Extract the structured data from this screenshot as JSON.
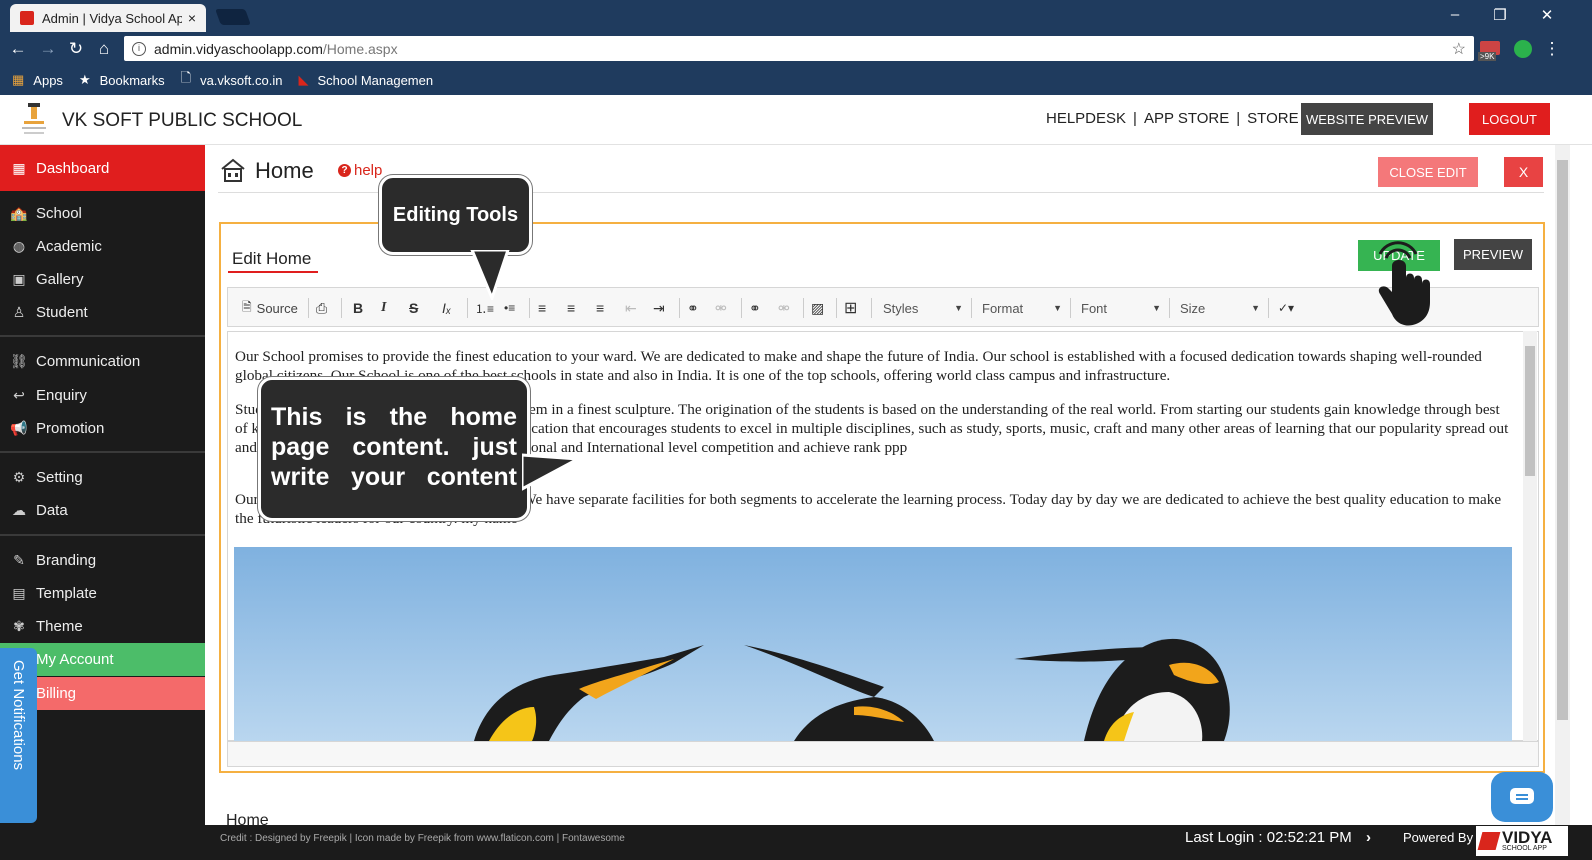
{
  "browser": {
    "tab_title": "Admin | Vidya School App",
    "tab_close": "×",
    "url_host": "admin.vidyaschoolapp.com",
    "url_path": "/Home.aspx",
    "ext_badge": ">9K",
    "bookmarks": [
      {
        "label": "Apps",
        "icon": "apps-grid-icon"
      },
      {
        "label": "Bookmarks",
        "icon": "star-icon"
      },
      {
        "label": "va.vksoft.co.in",
        "icon": "page-icon"
      },
      {
        "label": "School Managemen",
        "icon": "school-favicon"
      }
    ]
  },
  "header": {
    "school_name": "VK SOFT PUBLIC SCHOOL",
    "links": [
      "HELPDESK",
      "APP STORE",
      "STORE"
    ],
    "link_separator": "|",
    "website_preview": "WEBSITE PREVIEW",
    "logout": "LOGOUT"
  },
  "sidebar": {
    "items": [
      {
        "label": "Dashboard",
        "icon": "dashboard-icon"
      },
      {
        "label": "School",
        "icon": "school-icon"
      },
      {
        "label": "Academic",
        "icon": "globe-icon"
      },
      {
        "label": "Gallery",
        "icon": "image-icon"
      },
      {
        "label": "Student",
        "icon": "student-icon"
      },
      {
        "label": "Communication",
        "icon": "link-icon"
      },
      {
        "label": "Enquiry",
        "icon": "reply-icon"
      },
      {
        "label": "Promotion",
        "icon": "megaphone-icon"
      },
      {
        "label": "Setting",
        "icon": "gear-icon"
      },
      {
        "label": "Data",
        "icon": "cloud-icon"
      },
      {
        "label": "Branding",
        "icon": "brush-icon"
      },
      {
        "label": "Template",
        "icon": "template-icon"
      },
      {
        "label": "Theme",
        "icon": "palette-icon"
      },
      {
        "label": "My Account",
        "icon": ""
      },
      {
        "label": "Billing",
        "icon": ""
      }
    ],
    "notifications_tab": "Get Notifications"
  },
  "page": {
    "title": "Home",
    "help": "help",
    "close_edit": "CLOSE EDIT",
    "close_x": "X",
    "edit_heading": "Edit Home",
    "update": "UPDATE",
    "preview": "PREVIEW",
    "section_label": "Home"
  },
  "toolbar": {
    "source": "Source",
    "styles": "Styles",
    "format": "Format",
    "font": "Font",
    "size": "Size"
  },
  "editor": {
    "paragraphs": [
      "Our School promises to provide the finest education to your ward. We are dedicated to make and shape the future of India. Our school is established with a focused dedication towards shaping well-rounded global citizens. Our School is one of the best schools in state and also in India. It is one of the top schools, offering world class campus and infrastructure.",
      "Students are our prime responsibility to shape them in a finest sculpture. The origination of the students is based on the understanding of the real world. From starting our students gain knowledge through best of knowledge. We provide best and practical education that encourages students to excel in multiple disciplines, such as study, sports, music, craft and many other areas of learning that our popularity spread out and reaches to you. Our students participate National and International level competition and achieve rank ppp",
      "Our school has primary and secondary classes. We have separate facilities for both segments to accelerate the learning process. Today day by day we are dedicated to achieve the best quality education to make the futuristic leaders for our country. my name"
    ]
  },
  "callouts": {
    "tools": "Editing Tools",
    "content": "This is the home page content. just write your content"
  },
  "footer": {
    "credit": "Credit : Designed by Freepik | Icon made by Freepik from www.flaticon.com | Fontawesome",
    "last_login": "Last Login : 02:52:21 PM",
    "powered_by": "Powered By",
    "brand": "VIDYA",
    "brand_sub": "SCHOOL APP"
  },
  "colors": {
    "chrome": "#1f3b5e",
    "sidebar": "#1b1b1b",
    "accent_red": "#e01e1e",
    "account_green": "#4cbd69",
    "billing_pink": "#f46a6a",
    "update_green": "#36b452",
    "panel_border": "#f5b041",
    "notify_blue": "#3a8fd8"
  }
}
